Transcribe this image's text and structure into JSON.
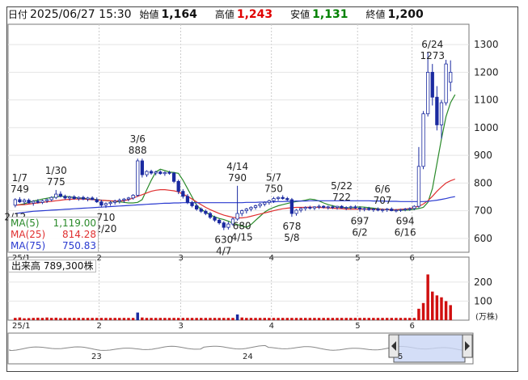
{
  "header": {
    "date_label": "日付",
    "date": "2025/06/27 15:30",
    "open_label": "始値",
    "open": "1,164",
    "high_label": "高値",
    "high": "1,243",
    "low_label": "安値",
    "low": "1,131",
    "close_label": "終値",
    "close": "1,200"
  },
  "colors": {
    "up": "#ffffff",
    "down": "#1a2aa0",
    "high": "#e00000",
    "low": "#008000",
    "ma5": "#2a8a2a",
    "ma25": "#e03030",
    "ma75": "#2a3ad0",
    "volume": "#d01010",
    "volume_alt": "#1a2aa0"
  },
  "legend": {
    "ma5_label": "MA(5)",
    "ma5_value": "1,119.00",
    "ma25_label": "MA(25)",
    "ma25_value": "814.28",
    "ma75_label": "MA(75)",
    "ma75_value": "750.83"
  },
  "volume_label": "出来高 789,300株",
  "volume_unit": "(万株)",
  "navigator": {
    "year_labels": [
      "23",
      "24",
      "5"
    ]
  },
  "chart_data": [
    {
      "type": "candlestick",
      "title": "",
      "ylim": [
        550,
        1350
      ],
      "yticks": [
        600,
        700,
        800,
        900,
        1000,
        1100,
        1200,
        1300
      ],
      "x_tick_labels": [
        "25/1",
        "2",
        "3",
        "4",
        "5",
        "6"
      ],
      "annotations": [
        {
          "date": "1/7",
          "value": 749,
          "kind": "high"
        },
        {
          "date": "1/30",
          "value": 775,
          "kind": "high"
        },
        {
          "date": "2/12",
          "value": null,
          "kind": "low"
        },
        {
          "date": "2/20",
          "value": 710,
          "kind": "low"
        },
        {
          "date": "3/6",
          "value": 888,
          "kind": "high"
        },
        {
          "date": "4/14",
          "value": 790,
          "kind": "high"
        },
        {
          "date": "4/7",
          "value": 630,
          "kind": "low"
        },
        {
          "date": "4/15",
          "value": 680,
          "kind": "low"
        },
        {
          "date": "5/7",
          "value": 750,
          "kind": "high"
        },
        {
          "date": "5/8",
          "value": 678,
          "kind": "low"
        },
        {
          "date": "5/22",
          "value": 722,
          "kind": "high"
        },
        {
          "date": "6/2",
          "value": 697,
          "kind": "low"
        },
        {
          "date": "6/6",
          "value": 707,
          "kind": "high"
        },
        {
          "date": "6/16",
          "value": 694,
          "kind": "low"
        },
        {
          "date": "6/24",
          "value": 1273,
          "kind": "high"
        }
      ],
      "series": [
        {
          "name": "MA(5)",
          "values": [
            720,
            722,
            725,
            730,
            735,
            738,
            742,
            745,
            748,
            750,
            752,
            752,
            750,
            748,
            746,
            745,
            743,
            742,
            740,
            738,
            737,
            735,
            733,
            732,
            730,
            728,
            728,
            730,
            740,
            775,
            810,
            840,
            850,
            845,
            840,
            838,
            835,
            810,
            780,
            750,
            720,
            705,
            695,
            685,
            678,
            672,
            668,
            662,
            655,
            650,
            645,
            640,
            650,
            665,
            680,
            695,
            705,
            712,
            718,
            722,
            726,
            730,
            733,
            735,
            738,
            742,
            740,
            735,
            728,
            722,
            718,
            714,
            712,
            711,
            710,
            712,
            714,
            713,
            711,
            709,
            707,
            705,
            704,
            703,
            702,
            702,
            702,
            703,
            705,
            708,
            712,
            730,
            780,
            870,
            960,
            1040,
            1090,
            1119
          ]
        },
        {
          "name": "MA(25)",
          "values": [
            720,
            721,
            722,
            724,
            726,
            728,
            730,
            732,
            734,
            736,
            738,
            740,
            741,
            742,
            742,
            742,
            741,
            740,
            739,
            738,
            737,
            736,
            735,
            735,
            736,
            740,
            746,
            752,
            758,
            764,
            770,
            774,
            776,
            776,
            774,
            772,
            768,
            760,
            752,
            742,
            732,
            722,
            712,
            704,
            697,
            690,
            684,
            680,
            676,
            674,
            674,
            676,
            680,
            684,
            688,
            692,
            696,
            700,
            704,
            707,
            709,
            711,
            712,
            712,
            712,
            713,
            713,
            712,
            711,
            710,
            709,
            708,
            707,
            706,
            706,
            706,
            706,
            706,
            706,
            706,
            705,
            705,
            704,
            704,
            704,
            705,
            706,
            708,
            712,
            716,
            724,
            736,
            752,
            770,
            786,
            800,
            808,
            814.28
          ]
        },
        {
          "name": "MA(75)",
          "values": [
            690,
            692,
            694,
            696,
            698,
            699,
            700,
            701,
            702,
            703,
            704,
            705,
            706,
            707,
            708,
            709,
            710,
            711,
            712,
            713,
            714,
            715,
            716,
            717,
            718,
            719,
            720,
            721,
            722,
            723,
            724,
            725,
            726,
            727,
            727,
            728,
            728,
            729,
            729,
            729,
            729,
            729,
            729,
            729,
            729,
            729,
            729,
            729,
            729,
            729,
            729,
            730,
            730,
            730,
            731,
            731,
            732,
            732,
            733,
            733,
            734,
            734,
            735,
            735,
            735,
            736,
            736,
            736,
            736,
            736,
            736,
            736,
            736,
            736,
            736,
            736,
            736,
            736,
            736,
            735,
            735,
            735,
            734,
            734,
            734,
            733,
            733,
            733,
            733,
            733,
            733,
            734,
            736,
            738,
            741,
            744,
            748,
            750.83
          ]
        }
      ],
      "candles": [
        [
          720,
          745,
          712,
          740
        ],
        [
          740,
          749,
          728,
          732
        ],
        [
          732,
          744,
          722,
          738
        ],
        [
          738,
          744,
          726,
          728
        ],
        [
          728,
          738,
          718,
          734
        ],
        [
          734,
          742,
          726,
          730
        ],
        [
          730,
          740,
          724,
          736
        ],
        [
          736,
          744,
          728,
          740
        ],
        [
          740,
          752,
          734,
          748
        ],
        [
          748,
          775,
          742,
          760
        ],
        [
          760,
          770,
          748,
          752
        ],
        [
          752,
          758,
          740,
          746
        ],
        [
          746,
          754,
          736,
          750
        ],
        [
          750,
          756,
          740,
          744
        ],
        [
          744,
          752,
          736,
          748
        ],
        [
          748,
          754,
          738,
          742
        ],
        [
          742,
          750,
          734,
          746
        ],
        [
          746,
          752,
          738,
          740
        ],
        [
          740,
          748,
          728,
          732
        ],
        [
          732,
          740,
          712,
          720
        ],
        [
          720,
          730,
          710,
          726
        ],
        [
          726,
          736,
          718,
          730
        ],
        [
          730,
          740,
          722,
          734
        ],
        [
          734,
          744,
          726,
          738
        ],
        [
          738,
          746,
          728,
          742
        ],
        [
          742,
          750,
          734,
          746
        ],
        [
          746,
          760,
          740,
          756
        ],
        [
          756,
          888,
          750,
          880
        ],
        [
          880,
          888,
          820,
          830
        ],
        [
          830,
          846,
          822,
          842
        ],
        [
          842,
          848,
          830,
          836
        ],
        [
          836,
          844,
          828,
          840
        ],
        [
          840,
          846,
          830,
          834
        ],
        [
          834,
          842,
          826,
          838
        ],
        [
          838,
          844,
          830,
          836
        ],
        [
          836,
          840,
          800,
          806
        ],
        [
          806,
          812,
          760,
          770
        ],
        [
          770,
          778,
          744,
          752
        ],
        [
          752,
          760,
          724,
          730
        ],
        [
          730,
          736,
          712,
          718
        ],
        [
          718,
          724,
          700,
          706
        ],
        [
          706,
          712,
          692,
          698
        ],
        [
          698,
          704,
          684,
          690
        ],
        [
          690,
          696,
          670,
          676
        ],
        [
          676,
          682,
          660,
          666
        ],
        [
          666,
          672,
          650,
          656
        ],
        [
          656,
          662,
          630,
          640
        ],
        [
          640,
          660,
          632,
          652
        ],
        [
          652,
          676,
          646,
          670
        ],
        [
          670,
          790,
          664,
          690
        ],
        [
          690,
          704,
          680,
          700
        ],
        [
          700,
          710,
          690,
          706
        ],
        [
          706,
          716,
          698,
          712
        ],
        [
          712,
          722,
          704,
          718
        ],
        [
          718,
          728,
          710,
          724
        ],
        [
          724,
          734,
          716,
          730
        ],
        [
          730,
          740,
          722,
          736
        ],
        [
          736,
          750,
          728,
          744
        ],
        [
          744,
          752,
          736,
          748
        ],
        [
          748,
          756,
          740,
          744
        ],
        [
          744,
          750,
          736,
          740
        ],
        [
          740,
          746,
          678,
          690
        ],
        [
          690,
          706,
          682,
          702
        ],
        [
          702,
          712,
          694,
          708
        ],
        [
          708,
          716,
          700,
          712
        ],
        [
          712,
          718,
          704,
          710
        ],
        [
          710,
          716,
          702,
          714
        ],
        [
          714,
          722,
          706,
          716
        ],
        [
          716,
          720,
          708,
          712
        ],
        [
          712,
          718,
          704,
          714
        ],
        [
          714,
          720,
          706,
          712
        ],
        [
          712,
          718,
          704,
          716
        ],
        [
          716,
          720,
          708,
          710
        ],
        [
          710,
          716,
          702,
          712
        ],
        [
          712,
          718,
          704,
          714
        ],
        [
          714,
          720,
          706,
          710
        ],
        [
          710,
          716,
          697,
          706
        ],
        [
          706,
          712,
          698,
          708
        ],
        [
          708,
          714,
          700,
          704
        ],
        [
          704,
          710,
          696,
          706
        ],
        [
          706,
          712,
          698,
          702
        ],
        [
          702,
          708,
          694,
          704
        ],
        [
          704,
          710,
          696,
          706
        ],
        [
          706,
          712,
          698,
          700
        ],
        [
          700,
          706,
          694,
          702
        ],
        [
          702,
          707,
          696,
          704
        ],
        [
          704,
          710,
          698,
          706
        ],
        [
          706,
          712,
          700,
          708
        ],
        [
          708,
          720,
          702,
          716
        ],
        [
          716,
          930,
          710,
          860
        ],
        [
          860,
          1060,
          850,
          1050
        ],
        [
          1050,
          1273,
          1040,
          1200
        ],
        [
          1200,
          1230,
          1080,
          1110
        ],
        [
          1110,
          1150,
          990,
          1010
        ],
        [
          1010,
          1100,
          960,
          1090
        ],
        [
          1090,
          1245,
          1080,
          1230
        ],
        [
          1164,
          1243,
          1131,
          1200
        ]
      ]
    },
    {
      "type": "bar",
      "title": "",
      "ylabel": "(万株)",
      "yticks": [
        100,
        200
      ],
      "ylim": [
        0,
        280
      ],
      "values": [
        12,
        14,
        10,
        11,
        12,
        13,
        12,
        14,
        12,
        13,
        11,
        12,
        12,
        12,
        12,
        12,
        12,
        12,
        12,
        12,
        12,
        12,
        12,
        12,
        12,
        12,
        12,
        40,
        14,
        12,
        12,
        12,
        12,
        12,
        12,
        12,
        12,
        12,
        12,
        12,
        12,
        12,
        12,
        12,
        12,
        12,
        12,
        12,
        12,
        30,
        14,
        12,
        12,
        12,
        12,
        12,
        12,
        12,
        12,
        12,
        12,
        12,
        12,
        12,
        12,
        12,
        12,
        12,
        12,
        12,
        12,
        12,
        12,
        12,
        12,
        12,
        12,
        12,
        12,
        12,
        12,
        12,
        12,
        12,
        12,
        12,
        12,
        12,
        12,
        60,
        90,
        240,
        150,
        130,
        120,
        100,
        78.93
      ]
    }
  ]
}
